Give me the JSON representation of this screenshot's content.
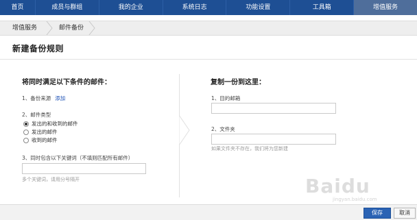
{
  "nav": {
    "items": [
      {
        "label": "首页"
      },
      {
        "label": "成员与群组"
      },
      {
        "label": "我的企业"
      },
      {
        "label": "系统日志"
      },
      {
        "label": "功能设置"
      },
      {
        "label": "工具箱"
      },
      {
        "label": "增值服务"
      }
    ],
    "active_index": 6
  },
  "breadcrumb": {
    "items": [
      "增值服务",
      "邮件备份"
    ]
  },
  "page": {
    "title": "新建备份规则"
  },
  "left": {
    "heading": "将同时满足以下条件的邮件：",
    "source_label": "1、备份来源",
    "source_add": "添加",
    "type_label": "2、邮件类型",
    "type_options": [
      "发出的和收到的邮件",
      "发出的邮件",
      "收到的邮件"
    ],
    "type_selected": 0,
    "keyword_label": "3、同时包含以下关键词（不填则匹配所有邮件）",
    "keyword_value": "",
    "keyword_hint": "多个关键词，请用分号隔开"
  },
  "right": {
    "heading": "复制一份到这里：",
    "dest_label": "1、目的邮箱",
    "dest_value": "",
    "folder_label": "2、文件夹",
    "folder_value": "",
    "folder_hint": "如果文件夹不存在，我们将为您新建"
  },
  "footer": {
    "save_label": "保存",
    "cancel_label": "取消"
  },
  "watermark": {
    "text": "Baidu",
    "sub": "jingyan.baidu.com"
  }
}
